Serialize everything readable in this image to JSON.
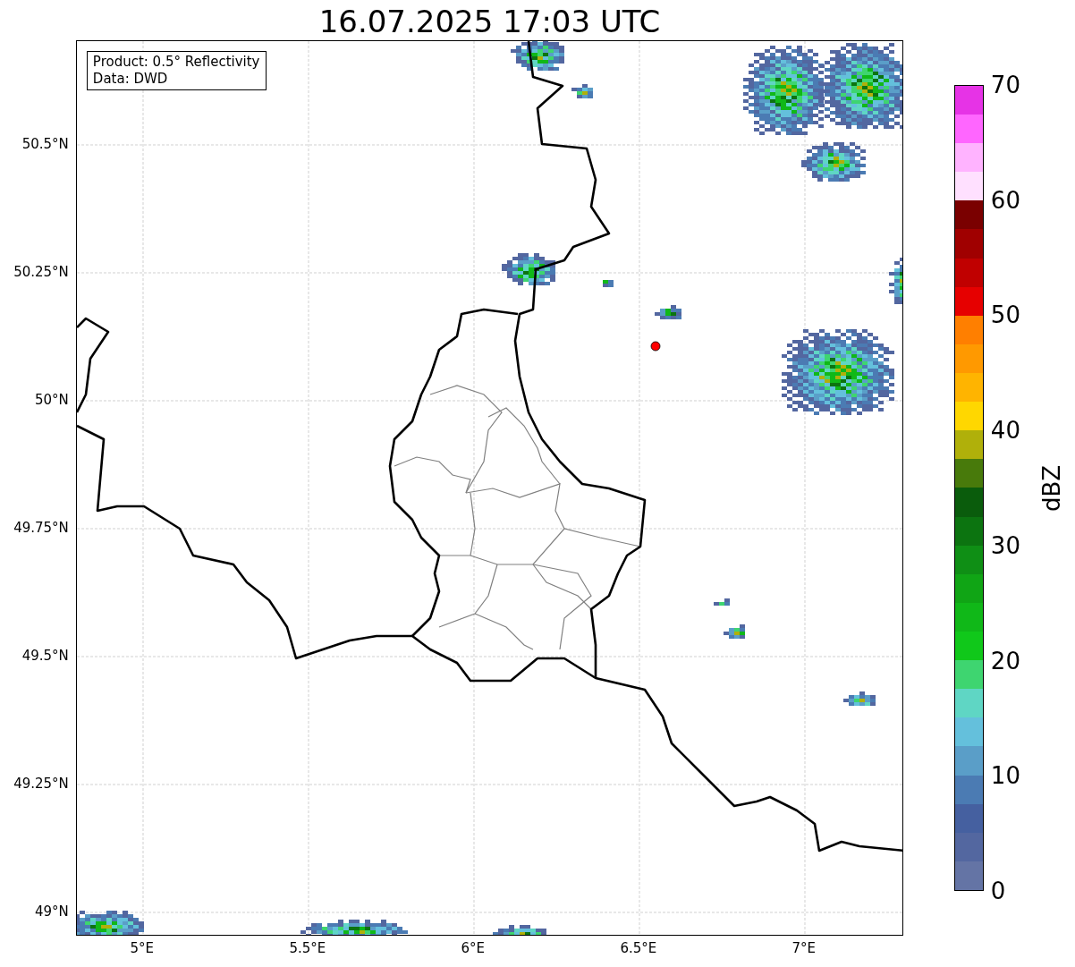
{
  "title": "16.07.2025 17:03 UTC",
  "info_box": {
    "lines": [
      "Product: 0.5° Reflectivity",
      "Data: DWD"
    ]
  },
  "map": {
    "lat_ticks": [
      "50.5°N",
      "50.25°N",
      "50°N",
      "49.75°N",
      "49.5°N",
      "49.25°N",
      "49°N"
    ],
    "lon_ticks": [
      "5°E",
      "5.5°E",
      "6°E",
      "6.5°E",
      "7°E"
    ]
  },
  "colorbar": {
    "label": "dBZ",
    "ticks": [
      "70",
      "60",
      "50",
      "40",
      "30",
      "20",
      "10",
      "0"
    ],
    "segments": [
      {
        "color": "#6474a5"
      },
      {
        "color": "#5367a0"
      },
      {
        "color": "#4560a0"
      },
      {
        "color": "#4b7bb3"
      },
      {
        "color": "#5a9ec8"
      },
      {
        "color": "#64c0dc"
      },
      {
        "color": "#5fd6c4"
      },
      {
        "color": "#3ed570"
      },
      {
        "color": "#10c81a"
      },
      {
        "color": "#10b818"
      },
      {
        "color": "#10a515"
      },
      {
        "color": "#0f8f15"
      },
      {
        "color": "#0c7410"
      },
      {
        "color": "#0a5c0c"
      },
      {
        "color": "#487a0b"
      },
      {
        "color": "#b0b00a"
      },
      {
        "color": "#ffd700"
      },
      {
        "color": "#ffb400"
      },
      {
        "color": "#ff9900"
      },
      {
        "color": "#ff7f00"
      },
      {
        "color": "#e60000"
      },
      {
        "color": "#c00000"
      },
      {
        "color": "#a00000"
      },
      {
        "color": "#7a0000"
      },
      {
        "color": "#ffe0ff"
      },
      {
        "color": "#ffb3ff"
      },
      {
        "color": "#ff66ff"
      },
      {
        "color": "#e633e6"
      }
    ]
  }
}
